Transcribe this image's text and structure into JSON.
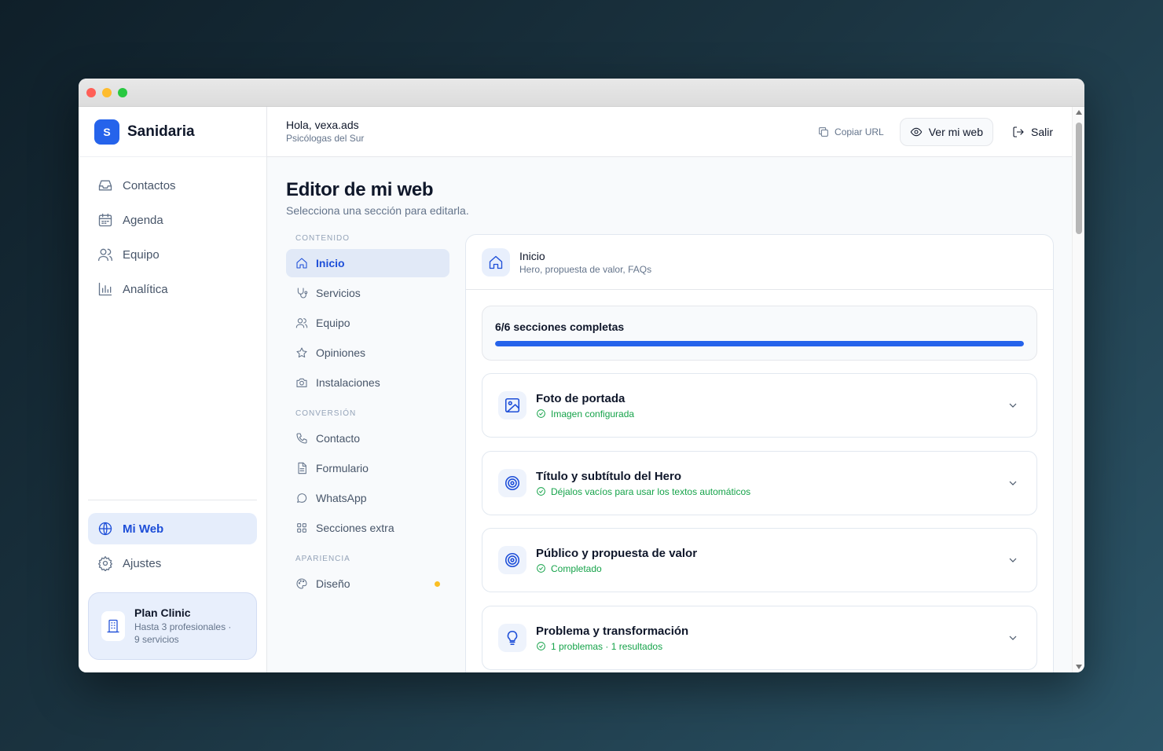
{
  "brand": {
    "initial": "S",
    "name": "Sanidaria"
  },
  "sidebar": {
    "items": [
      {
        "label": "Contactos",
        "icon": "inbox-icon"
      },
      {
        "label": "Agenda",
        "icon": "calendar-icon"
      },
      {
        "label": "Equipo",
        "icon": "users-icon"
      },
      {
        "label": "Analítica",
        "icon": "bar-chart-icon"
      }
    ],
    "bottom_items": [
      {
        "label": "Mi Web",
        "icon": "globe-icon",
        "active": true
      },
      {
        "label": "Ajustes",
        "icon": "gear-icon"
      }
    ],
    "plan": {
      "title": "Plan Clinic",
      "desc_line1": "Hasta 3 profesionales ·",
      "desc_line2": "9 servicios"
    }
  },
  "header": {
    "greeting": "Hola, vexa.ads",
    "subtitle": "Psicólogas del Sur",
    "copy_label": "Copiar URL",
    "view_label": "Ver mi web",
    "logout_label": "Salir"
  },
  "main": {
    "title": "Editor de mi web",
    "subtitle": "Selecciona una sección para editarla."
  },
  "subnav": {
    "content_heading": "CONTENIDO",
    "content_items": [
      {
        "label": "Inicio",
        "icon": "home-icon",
        "active": true
      },
      {
        "label": "Servicios",
        "icon": "stethoscope-icon"
      },
      {
        "label": "Equipo",
        "icon": "users-icon"
      },
      {
        "label": "Opiniones",
        "icon": "star-icon"
      },
      {
        "label": "Instalaciones",
        "icon": "camera-icon"
      }
    ],
    "conversion_heading": "CONVERSIÓN",
    "conversion_items": [
      {
        "label": "Contacto",
        "icon": "phone-icon"
      },
      {
        "label": "Formulario",
        "icon": "file-icon"
      },
      {
        "label": "WhatsApp",
        "icon": "chat-icon"
      },
      {
        "label": "Secciones extra",
        "icon": "grid-icon"
      }
    ],
    "appearance_heading": "APARIENCIA",
    "appearance_items": [
      {
        "label": "Diseño",
        "icon": "palette-icon",
        "badge_color": "#fbbf24"
      }
    ]
  },
  "panel": {
    "title": "Inicio",
    "subtitle": "Hero, propuesta de valor, FAQs",
    "progress_label": "6/6 secciones completas",
    "progress": 1.0,
    "sections": [
      {
        "title": "Foto de portada",
        "status": "Imagen configurada",
        "icon": "image-icon"
      },
      {
        "title": "Título y subtítulo del Hero",
        "status": "Déjalos vacíos para usar los textos automáticos",
        "icon": "target-icon"
      },
      {
        "title": "Público y propuesta de valor",
        "status": "Completado",
        "icon": "target-icon"
      },
      {
        "title": "Problema y transformación",
        "status": "1 problemas · 1 resultados",
        "icon": "lightbulb-icon"
      }
    ]
  },
  "colors": {
    "accent": "#2563eb",
    "success": "#16a34a",
    "warning_dot": "#fbbf24"
  }
}
